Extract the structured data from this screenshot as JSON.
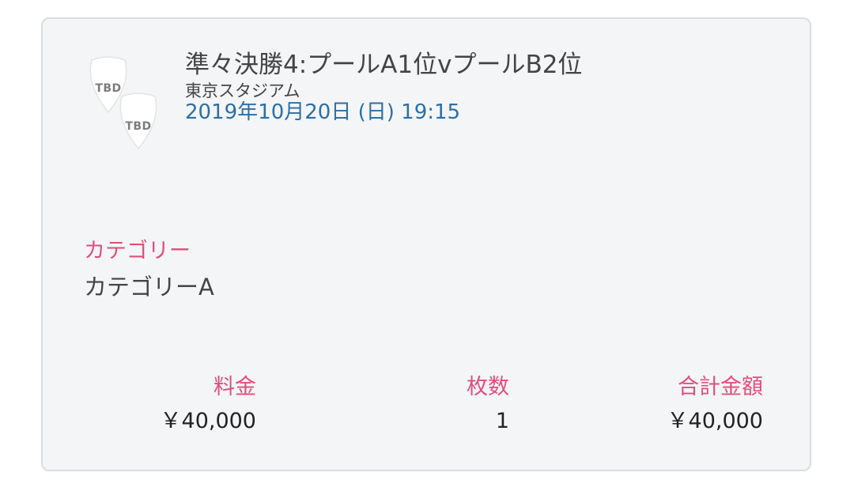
{
  "match": {
    "badges": [
      "TBD",
      "TBD"
    ],
    "title": "準々決勝4:プールA1位vプールB2位",
    "venue": "東京スタジアム",
    "datetime": "2019年10月20日 (日) 19:15"
  },
  "category": {
    "label": "カテゴリー",
    "value": "カテゴリーA"
  },
  "summary": {
    "price_label": "料金",
    "price_value": "￥40,000",
    "quantity_label": "枚数",
    "quantity_value": "1",
    "total_label": "合計金額",
    "total_value": "￥40,000"
  },
  "colors": {
    "accent_pink": "#e04f7a",
    "date_blue": "#2e6fa3",
    "card_bg": "#f4f5f7"
  }
}
